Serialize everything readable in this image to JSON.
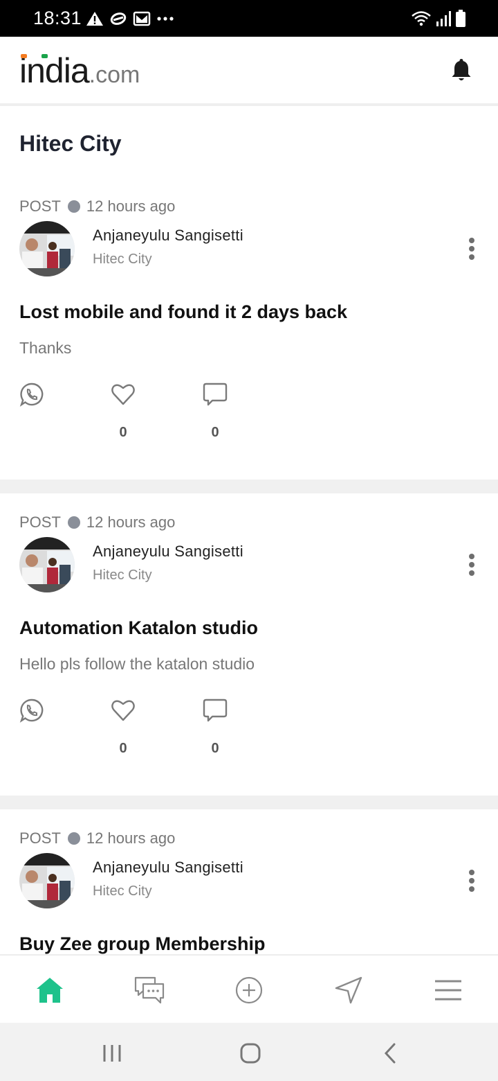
{
  "status_bar": {
    "time": "18:31",
    "left_icons": [
      "warning-icon",
      "link-icon",
      "gmail-icon",
      "more-dots-icon"
    ],
    "right_icons": [
      "wifi-icon",
      "signal-icon",
      "battery-icon"
    ]
  },
  "header": {
    "logo_main": "india",
    "logo_suffix": ".com",
    "logo_accent_colors": [
      "#f47b20",
      "#1aa34a"
    ],
    "notification_icon": "bell-icon"
  },
  "page": {
    "title": "Hitec City"
  },
  "posts": [
    {
      "type": "POST",
      "time": "12 hours ago",
      "author": "Anjaneyulu Sangisetti",
      "location": "Hitec City",
      "title": "Lost mobile and found it 2 days back",
      "body": "Thanks",
      "likes": "0",
      "comments": "0"
    },
    {
      "type": "POST",
      "time": "12 hours ago",
      "author": "Anjaneyulu Sangisetti",
      "location": "Hitec City",
      "title": "Automation Katalon studio",
      "body": "Hello pls follow the katalon studio",
      "likes": "0",
      "comments": "0"
    },
    {
      "type": "POST",
      "time": "12 hours ago",
      "author": "Anjaneyulu Sangisetti",
      "location": "Hitec City",
      "title": "Buy Zee group Membership",
      "body": "",
      "likes": "",
      "comments": ""
    }
  ],
  "bottom_nav": {
    "items": [
      "home-icon",
      "chat-icon",
      "add-post-icon",
      "navigate-icon",
      "menu-icon"
    ],
    "active_color": "#1ec28b",
    "inactive_color": "#8a8a8a"
  },
  "system_nav": {
    "items": [
      "recent-apps-icon",
      "home-circle-icon",
      "back-icon"
    ]
  }
}
